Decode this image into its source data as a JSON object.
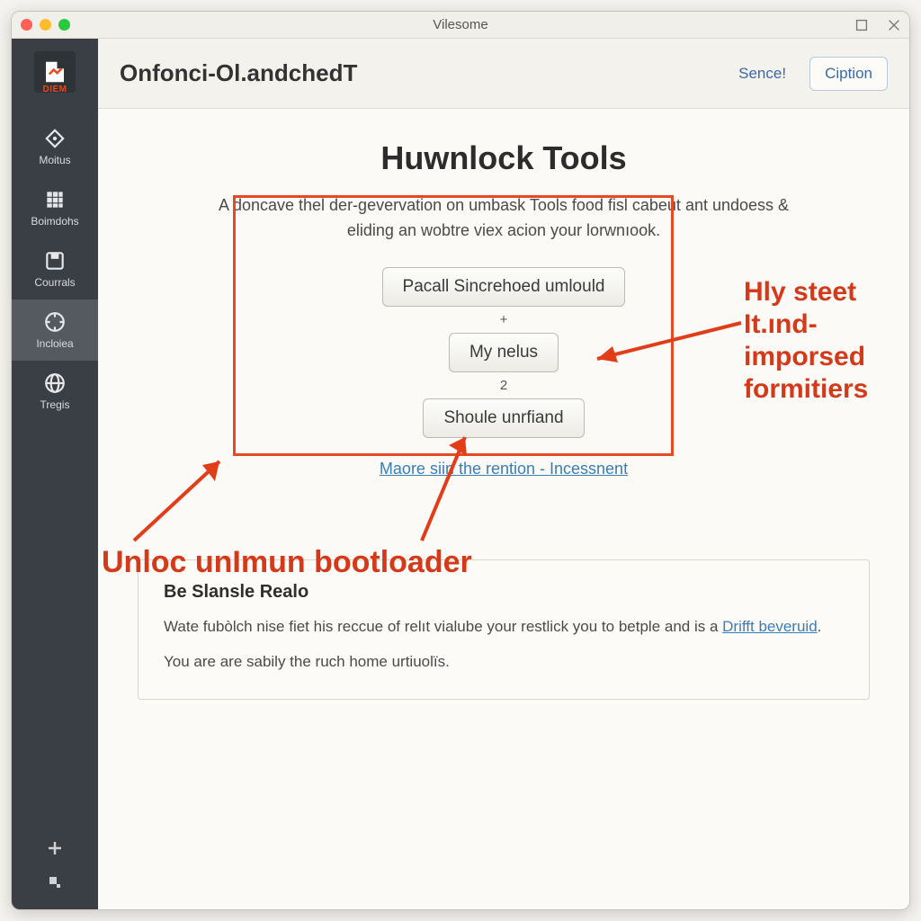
{
  "window": {
    "title": "Vilesome"
  },
  "sidebar": {
    "logo_text": "DIEM",
    "items": [
      {
        "label": "Moitus"
      },
      {
        "label": "Boimdohs"
      },
      {
        "label": "Courrals"
      },
      {
        "label": "Incloiea"
      },
      {
        "label": "Tregis"
      }
    ]
  },
  "header": {
    "title": "Onfonci-Ol.andchedT",
    "btn_primary": "Sence!",
    "btn_secondary": "Ciption"
  },
  "hero": {
    "title": "Huwnlock Tools",
    "desc": "A doncave thel der-gevervation on umbask Tools food fisl cabeut ant undoess & eliding an wobtre viex acion your lorwnıook.",
    "btn1": "Pacall Sincrehoed umlould",
    "step1": "+",
    "btn2": "My nelus",
    "step2": "2",
    "btn3": "Shoule unrfiand",
    "more": "Maore siin the rention - Incessnent"
  },
  "annotations": {
    "right_text": "Hly steet It.ınd-imporsed formitiers",
    "bottom_text": "Unloc unImun bootloader"
  },
  "card": {
    "title": "Be Slansle Realo",
    "line1_pre": "Wate fubòlch nise fiet his reccue of relıt vialube your restlick you to betple and is a ",
    "line1_link": "Drifft beveruid",
    "line1_post": ".",
    "line2": "You are are sabily the ruch home urtiuolïs."
  }
}
